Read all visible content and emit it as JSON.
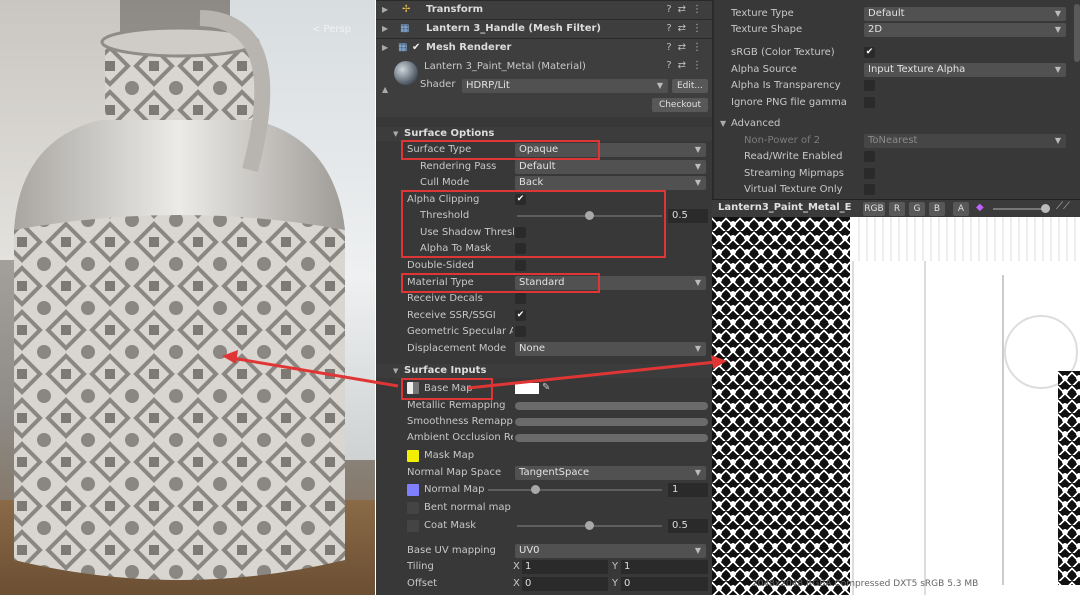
{
  "scene": {
    "persp_label": "< Persp"
  },
  "inspector": {
    "components": [
      {
        "name": "Transform"
      },
      {
        "name": "Lantern 3_Handle (Mesh Filter)"
      },
      {
        "name": "Mesh Renderer"
      }
    ],
    "material": {
      "name": "Lantern 3_Paint_Metal (Material)",
      "shader_label": "Shader",
      "shader_value": "HDRP/Lit",
      "edit_button": "Edit...",
      "checkout_button": "Checkout"
    },
    "surface_options": {
      "title": "Surface Options",
      "surface_type": {
        "label": "Surface Type",
        "value": "Opaque"
      },
      "rendering_pass": {
        "label": "Rendering Pass",
        "value": "Default"
      },
      "cull_mode": {
        "label": "Cull Mode",
        "value": "Back"
      },
      "alpha_clipping": {
        "label": "Alpha Clipping",
        "checked": true
      },
      "threshold": {
        "label": "Threshold",
        "value": "0.5",
        "level": 0.5
      },
      "use_shadow_threshold": {
        "label": "Use Shadow Thresh",
        "checked": false
      },
      "alpha_to_mask": {
        "label": "Alpha To Mask",
        "checked": false
      },
      "double_sided": {
        "label": "Double-Sided",
        "checked": false
      },
      "material_type": {
        "label": "Material Type",
        "value": "Standard"
      },
      "receive_decals": {
        "label": "Receive Decals",
        "checked": false
      },
      "receive_ssr": {
        "label": "Receive SSR/SSGI",
        "checked": true
      },
      "geometric_specular": {
        "label": "Geometric Specular A",
        "checked": false
      },
      "displacement_mode": {
        "label": "Displacement Mode",
        "value": "None"
      }
    },
    "surface_inputs": {
      "title": "Surface Inputs",
      "base_map": {
        "label": "Base Map"
      },
      "metallic_remapping": {
        "label": "Metallic Remapping"
      },
      "smoothness_remapping": {
        "label": "Smoothness Remappi"
      },
      "ao_remapping": {
        "label": "Ambient Occlusion Re"
      },
      "mask_map": {
        "label": "Mask Map",
        "color": "#f0f000"
      },
      "normal_map_space": {
        "label": "Normal Map Space",
        "value": "TangentSpace"
      },
      "normal_map": {
        "label": "Normal Map",
        "value": "1",
        "color": "#8080ff",
        "level": 0.0
      },
      "bent_normal_map": {
        "label": "Bent normal map"
      },
      "coat_mask": {
        "label": "Coat Mask",
        "value": "0.5",
        "level": 0.5
      },
      "base_uv_mapping": {
        "label": "Base UV mapping",
        "value": "UV0"
      },
      "tiling": {
        "label": "Tiling",
        "x_label": "X",
        "x": "1",
        "y_label": "Y",
        "y": "1"
      },
      "offset": {
        "label": "Offset",
        "x_label": "X",
        "x": "0",
        "y_label": "Y",
        "y": "0"
      }
    }
  },
  "importer": {
    "texture_type": {
      "label": "Texture Type",
      "value": "Default"
    },
    "texture_shape": {
      "label": "Texture Shape",
      "value": "2D"
    },
    "srgb": {
      "label": "sRGB (Color Texture)",
      "checked": true
    },
    "alpha_source": {
      "label": "Alpha Source",
      "value": "Input Texture Alpha"
    },
    "alpha_is_transparency": {
      "label": "Alpha Is Transparency"
    },
    "ignore_png_gamma": {
      "label": "Ignore PNG file gamma"
    },
    "advanced": {
      "title": "Advanced"
    },
    "non_power_of_2": {
      "label": "Non-Power of 2",
      "value": "ToNearest"
    },
    "read_write": {
      "label": "Read/Write Enabled"
    },
    "streaming_mipmaps": {
      "label": "Streaming Mipmaps"
    },
    "virtual_texture": {
      "label": "Virtual Texture Only"
    }
  },
  "preview": {
    "title": "Lantern3_Paint_Metal_E",
    "channels": [
      "RGB",
      "R",
      "G",
      "B",
      "A"
    ],
    "footer": "2048x2048 RGBA Compressed DXT5 sRGB 5.3 MB"
  }
}
